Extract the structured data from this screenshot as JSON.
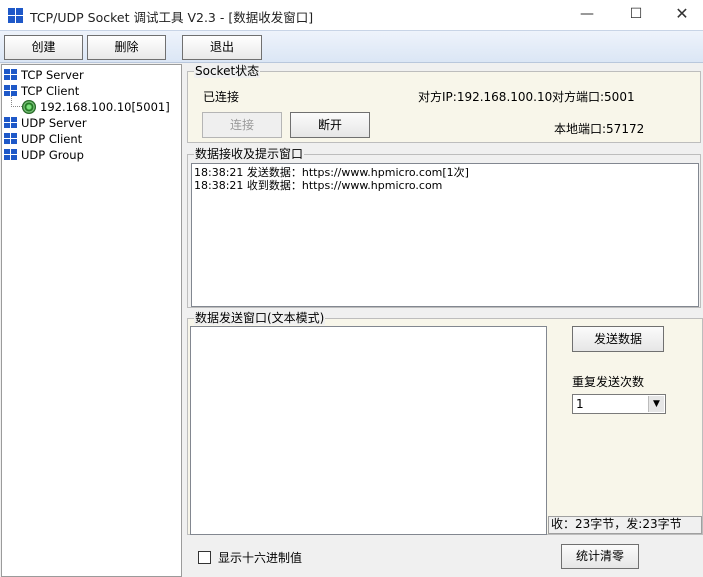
{
  "window": {
    "title": "TCP/UDP Socket 调试工具 V2.3 - [数据收发窗口]",
    "min_icon": "—",
    "max_icon": "☐",
    "close_icon": "✕"
  },
  "toolbar": {
    "create_label": "创建",
    "delete_label": "删除",
    "exit_label": "退出"
  },
  "tree": {
    "items": [
      {
        "label": "TCP Server"
      },
      {
        "label": "TCP Client"
      },
      {
        "label": "192.168.100.10[5001]"
      },
      {
        "label": "UDP Server"
      },
      {
        "label": "UDP Client"
      },
      {
        "label": "UDP Group"
      }
    ]
  },
  "socket": {
    "group_title": "Socket状态",
    "status": "已连接",
    "remote_ip": "对方IP:192.168.100.10",
    "remote_port": "对方端口:5001",
    "local_port": "本地端口:57172",
    "connect_label": "连接",
    "disconnect_label": "断开"
  },
  "receive": {
    "group_title": "数据接收及提示窗口",
    "lines": [
      "18:38:21 发送数据：https://www.hpmicro.com[1次]",
      "18:38:21 收到数据：https://www.hpmicro.com"
    ]
  },
  "send": {
    "group_title": "数据发送窗口(文本模式)",
    "send_label": "发送数据",
    "repeat_label": "重复发送次数",
    "repeat_value": "1",
    "stats": "收：23字节，发:23字节"
  },
  "footer": {
    "hex_label": "显示十六进制值",
    "clear_label": "统计清零"
  },
  "colors": {
    "icon_blue": "#1e58c8",
    "panel_bg": "#f8f6ea",
    "toolbar_bg": "#dbe6f5"
  }
}
